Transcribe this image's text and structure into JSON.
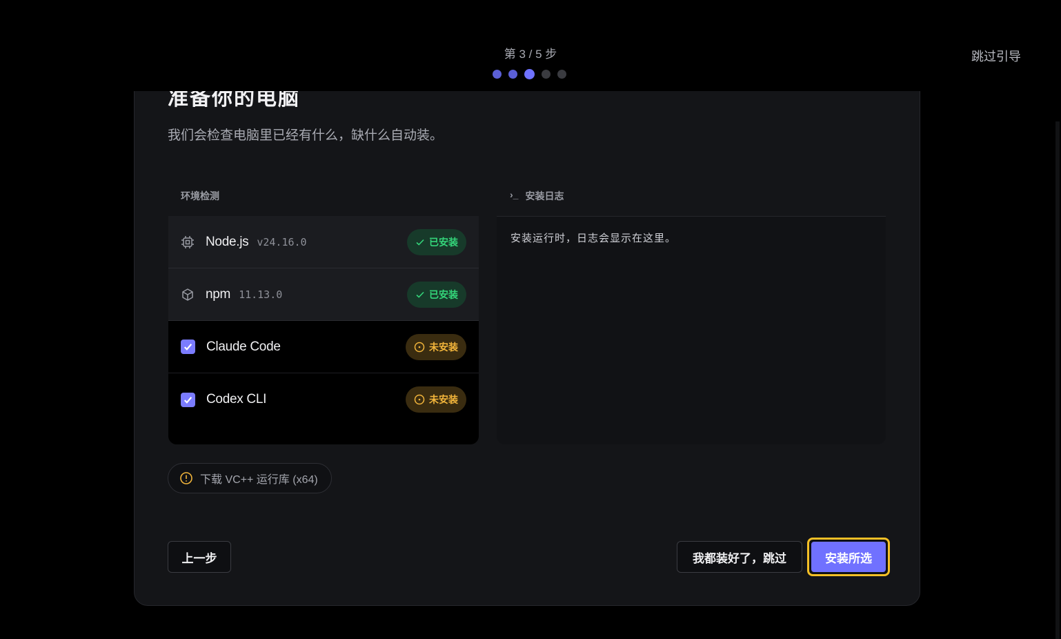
{
  "header": {
    "step_text": "第 3 / 5 步",
    "skip_guide": "跳过引导",
    "steps_total": 5,
    "steps_current": 3
  },
  "card": {
    "title": "准备你的电脑",
    "subtitle": "我们会检查电脑里已经有什么，缺什么自动装。"
  },
  "env": {
    "label": "环境检测",
    "items": [
      {
        "name": "Node.js",
        "version": "v24.16.0",
        "status": "已安装",
        "icon": "chip-icon"
      },
      {
        "name": "npm",
        "version": "11.13.0",
        "status": "已安装",
        "icon": "package-icon"
      },
      {
        "name": "Claude Code",
        "version": "",
        "status": "未安装",
        "checked": true
      },
      {
        "name": "Codex CLI",
        "version": "",
        "status": "未安装",
        "checked": true
      }
    ]
  },
  "log": {
    "label_prefix": "›_",
    "label": "安装日志",
    "placeholder": "安装运行时，日志会显示在这里。"
  },
  "vc": {
    "label": "下载 VC++ 运行库 (x64)"
  },
  "buttons": {
    "prev": "上一步",
    "skip_installed": "我都装好了，跳过",
    "install_selected": "安装所选"
  },
  "colors": {
    "accent": "#7071ff",
    "installed": "#34d57a",
    "missing": "#f2b53b",
    "focus": "#f5c026"
  }
}
